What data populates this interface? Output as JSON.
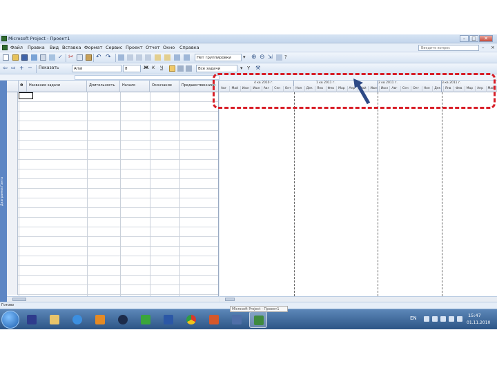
{
  "window": {
    "title": "Microsoft Project - Проект1"
  },
  "menu": {
    "items": [
      "Файл",
      "Правка",
      "Вид",
      "Вставка",
      "Формат",
      "Сервис",
      "Проект",
      "Отчет",
      "Окно",
      "Справка"
    ],
    "help_placeholder": "Введите вопрос"
  },
  "toolbar1": {
    "group_combo": "Нет группировки"
  },
  "toolbar2": {
    "show_label": "Показать",
    "font": "Arial",
    "size": "8",
    "bold": "Ж",
    "italic": "К",
    "underline": "Ч",
    "filter": "Все задачи"
  },
  "viewbar": {
    "label": "Диаграмма Ганта"
  },
  "table": {
    "columns": [
      "",
      "Название задачи",
      "Длительность",
      "Начало",
      "Окончание",
      "Предшественники"
    ]
  },
  "timescale": {
    "quarters": [
      "4 кв 2010 г.",
      "1 кв 2011 г.",
      "2 кв 2011 г.",
      "3 кв 2011 г."
    ],
    "months": [
      "Авг",
      "Май",
      "Июн",
      "Июл",
      "Авг",
      "Сен",
      "Окт",
      "Ноя",
      "Дек",
      "Янв",
      "Фев",
      "Мар",
      "Апр",
      "Май",
      "Июн",
      "Июл",
      "Авг",
      "Сен",
      "Окт",
      "Ноя",
      "Дек",
      "Янв",
      "Фев",
      "Мар",
      "Апр",
      "Май"
    ]
  },
  "status": {
    "text": "Готово"
  },
  "tooltip": {
    "text": "Microsoft Project - Проект1"
  },
  "taskbar": {
    "language": "EN",
    "time": "15:47",
    "date": "01.11.2010"
  },
  "colors": {
    "highlight": "#d81e27",
    "arrow": "#2e4a86",
    "taskbar": "#2d5586"
  },
  "icons": [
    "start-orb",
    "save-icon",
    "folder-icon",
    "ie-icon",
    "media-icon",
    "hp-icon",
    "utorrent-icon",
    "word-icon",
    "chrome-icon",
    "powerpoint-icon",
    "reader-icon",
    "project-icon"
  ]
}
